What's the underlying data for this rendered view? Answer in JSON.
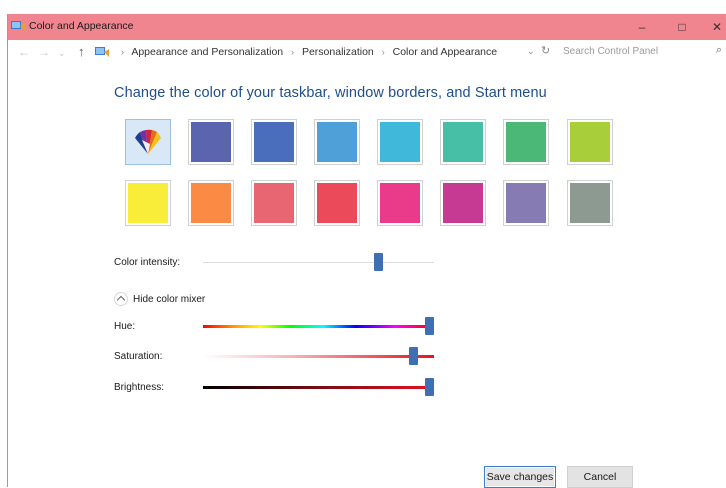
{
  "window": {
    "title": "Color and Appearance",
    "title_bar_color": "#f0858f",
    "controls": {
      "minimize": "–",
      "maximize": "□",
      "close": "✕"
    }
  },
  "nav": {
    "back_icon": "←",
    "forward_icon": "→",
    "up_icon": "↑",
    "breadcrumbs": [
      "Appearance and Personalization",
      "Personalization",
      "Color and Appearance"
    ],
    "separator": "›",
    "dropdown_icon": "⌄",
    "refresh_icon": "↻",
    "search_placeholder": "Search Control Panel",
    "search_icon": "⌕"
  },
  "main": {
    "heading": "Change the color of your taskbar, window borders, and Start menu",
    "swatches": [
      {
        "name": "automatic",
        "color": "#d9e8f6"
      },
      {
        "name": "slate-blue",
        "color": "#5b64ae"
      },
      {
        "name": "cobalt",
        "color": "#4a6ebc"
      },
      {
        "name": "sky-blue",
        "color": "#4f9fd9"
      },
      {
        "name": "cyan",
        "color": "#3fb8d9"
      },
      {
        "name": "teal",
        "color": "#47bea6"
      },
      {
        "name": "green",
        "color": "#4cb878"
      },
      {
        "name": "lime",
        "color": "#a8cf3a"
      },
      {
        "name": "yellow",
        "color": "#faed3a"
      },
      {
        "name": "orange",
        "color": "#fb8a45"
      },
      {
        "name": "coral",
        "color": "#e86672"
      },
      {
        "name": "red",
        "color": "#ea4a5a"
      },
      {
        "name": "pink",
        "color": "#ea3b8b"
      },
      {
        "name": "magenta",
        "color": "#c73a93"
      },
      {
        "name": "lavender",
        "color": "#867cb3"
      },
      {
        "name": "gray",
        "color": "#8d9a92"
      }
    ],
    "color_intensity_label": "Color intensity:",
    "color_intensity_level": 0.77,
    "mixer_toggle_label": "Hide color mixer",
    "hue_label": "Hue:",
    "hue_level": 1.0,
    "saturation_label": "Saturation:",
    "saturation_level": 0.93,
    "brightness_label": "Brightness:",
    "brightness_level": 1.0,
    "accent_color": "#3e6fb5"
  },
  "footer": {
    "save_label": "Save changes",
    "cancel_label": "Cancel"
  }
}
